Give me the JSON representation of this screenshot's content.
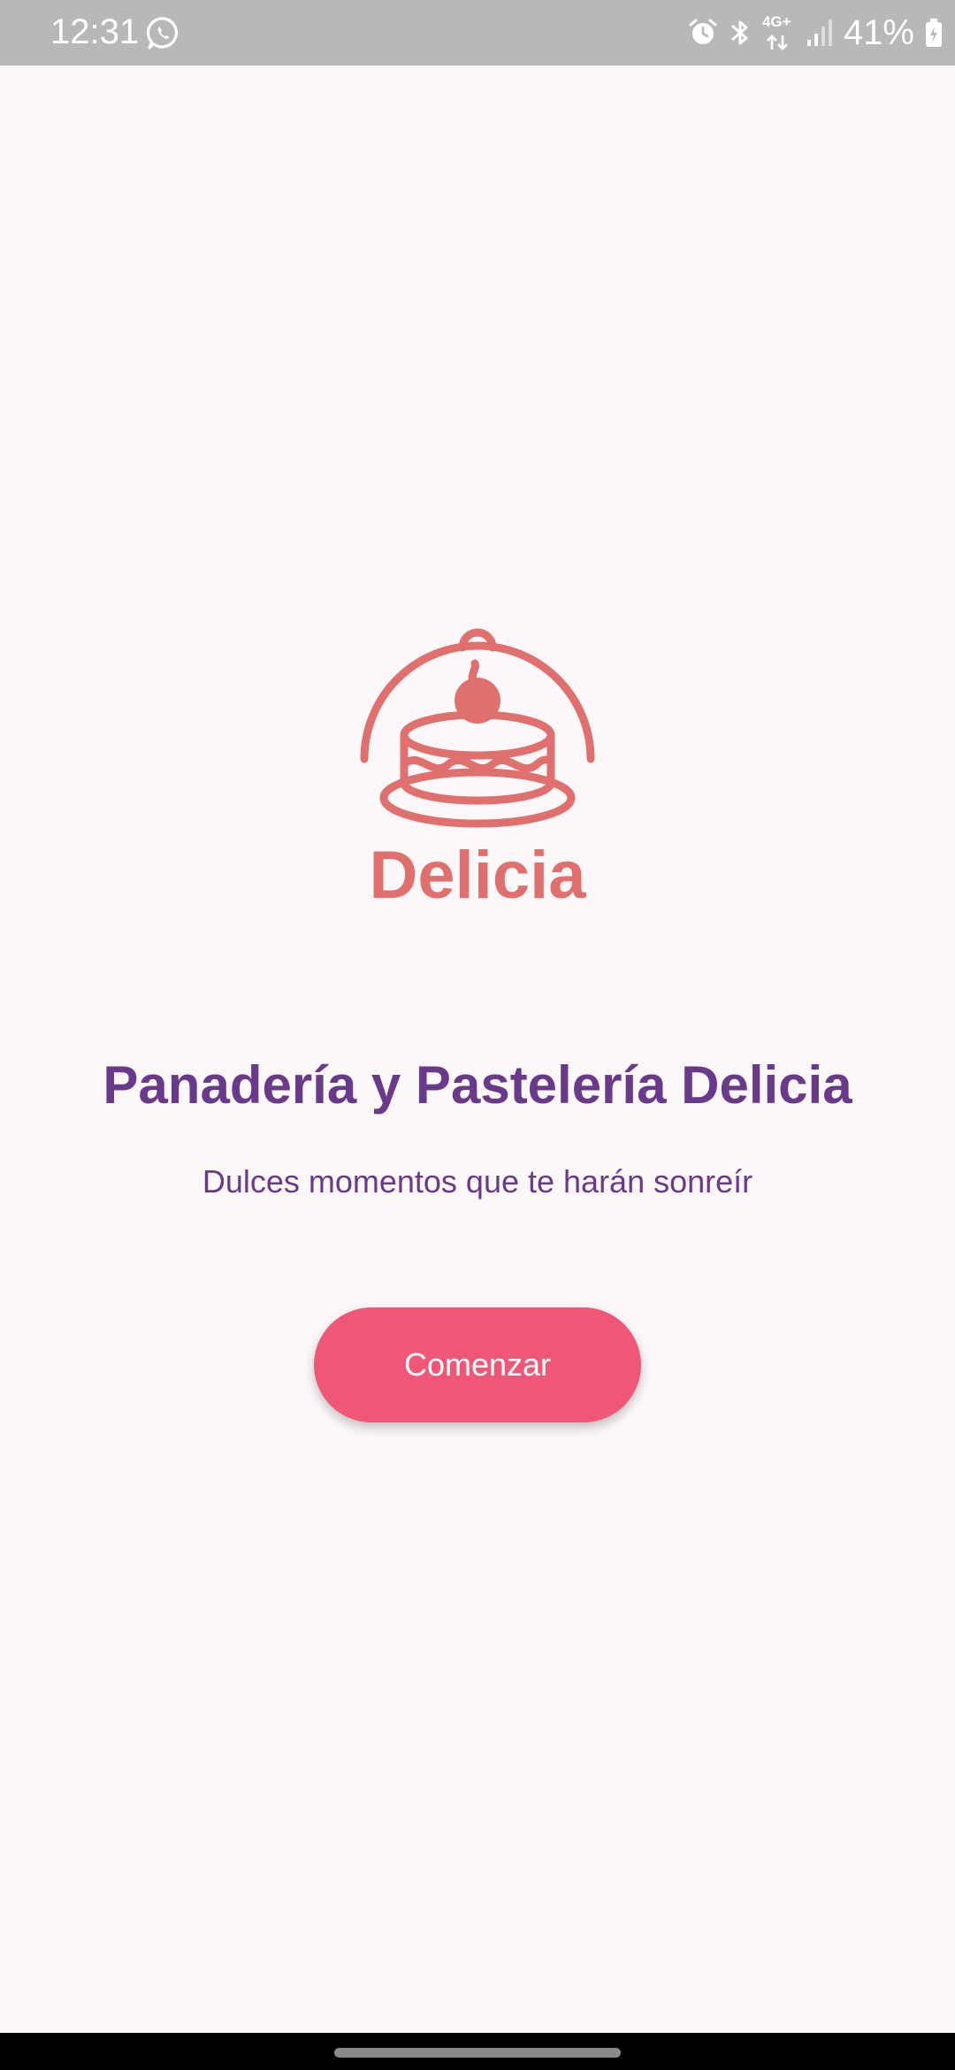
{
  "status_bar": {
    "time": "12:31",
    "battery_percent": "41%",
    "network_label": "4G+",
    "icons": [
      "whatsapp-icon",
      "alarm-icon",
      "bluetooth-icon",
      "network-4g-icon",
      "signal-icon",
      "battery-icon"
    ]
  },
  "logo": {
    "wordmark": "Delicia",
    "color": "#e0706d"
  },
  "main": {
    "title": "Panadería y Pastelería Delicia",
    "subtitle": "Dulces momentos que te harán sonreír",
    "start_button_label": "Comenzar"
  },
  "colors": {
    "background": "#fcf7f9",
    "title": "#6a3a8a",
    "button": "#f05777",
    "logo": "#e0706d"
  }
}
